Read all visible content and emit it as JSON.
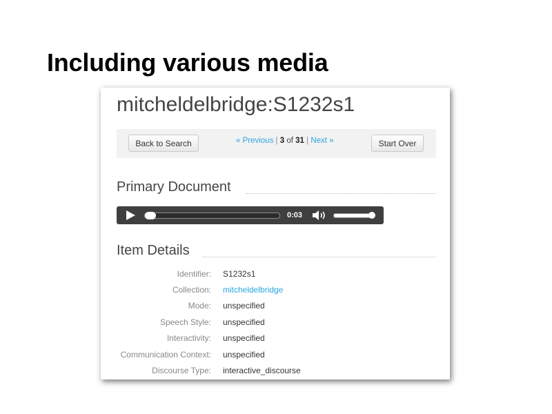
{
  "slide": {
    "title": "Including various media"
  },
  "record": {
    "title": "mitcheldelbridge:S1232s1"
  },
  "nav": {
    "back_label": "Back to Search",
    "previous_label": "« Previous",
    "separator": "|",
    "current": "3",
    "of_label": "of",
    "total": "31",
    "next_label": "Next »",
    "start_over_label": "Start Over"
  },
  "primary_document": {
    "heading": "Primary Document",
    "player": {
      "time": "0:03",
      "progress": 0.0,
      "volume": 1.0
    }
  },
  "item_details": {
    "heading": "Item Details",
    "rows": [
      {
        "label": "Identifier:",
        "value": "S1232s1"
      },
      {
        "label": "Collection:",
        "value": "mitcheldelbridge"
      },
      {
        "label": "Mode:",
        "value": "unspecified"
      },
      {
        "label": "Speech Style:",
        "value": "unspecified"
      },
      {
        "label": "Interactivity:",
        "value": "unspecified"
      },
      {
        "label": "Communication Context:",
        "value": "unspecified"
      },
      {
        "label": "Discourse Type:",
        "value": "interactive_discourse"
      }
    ]
  },
  "colors": {
    "link": "#2ba6de",
    "player_bg": "#3f3f3f",
    "nav_bg": "#f2f2f2"
  }
}
